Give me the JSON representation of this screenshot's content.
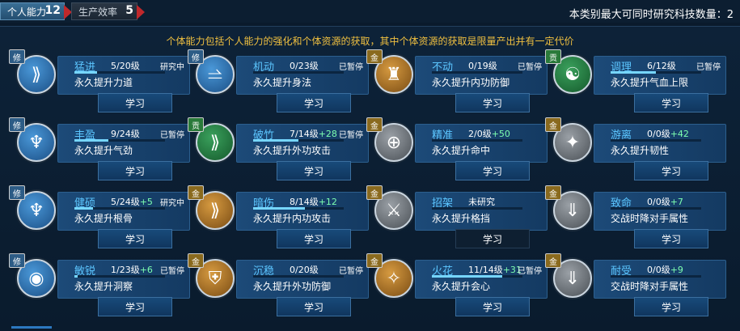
{
  "tabs": [
    {
      "label": "个人能力",
      "count": "12"
    },
    {
      "label": "生产效率",
      "count": "5"
    }
  ],
  "capacity_text": "本类别最大可同时研究科技数量：2",
  "description": "个体能力包括个人能力的强化和个体资源的获取，其中个体资源的获取是限量产出并有一定代价",
  "learn_label": "学习",
  "skills": [
    {
      "name": "猛进",
      "level": "5/20级",
      "bonus": "",
      "status": "研究中",
      "effect": "永久提升力道",
      "badge": "修",
      "color": "blue",
      "icon": "sprint-icon",
      "progress": 0.25,
      "glyph": "⟫"
    },
    {
      "name": "机动",
      "level": "0/23级",
      "bonus": "",
      "status": "已暂停",
      "effect": "永久提升身法",
      "badge": "修",
      "color": "blue",
      "icon": "boot-icon",
      "progress": 0.0,
      "glyph": "⥬"
    },
    {
      "name": "不动",
      "level": "0/19级",
      "bonus": "",
      "status": "已暂停",
      "effect": "永久提升内功防御",
      "badge": "金",
      "color": "gold",
      "icon": "stance-icon",
      "progress": 0.0,
      "glyph": "♜"
    },
    {
      "name": "调理",
      "level": "6/12级",
      "bonus": "",
      "status": "已暂停",
      "effect": "永久提升气血上限",
      "badge": "贡",
      "color": "green",
      "icon": "meditate-icon",
      "progress": 0.5,
      "glyph": "☯"
    },
    {
      "name": "丰盈",
      "level": "9/24级",
      "bonus": "",
      "status": "已暂停",
      "effect": "永久提升气劲",
      "badge": "修",
      "color": "blue",
      "icon": "muscle-icon",
      "progress": 0.375,
      "glyph": "♆"
    },
    {
      "name": "破竹",
      "level": "7/14级",
      "bonus": "+28",
      "status": "已暂停",
      "effect": "永久提升外功攻击",
      "badge": "贡",
      "color": "green",
      "icon": "dash-icon",
      "progress": 0.5,
      "glyph": "⟫"
    },
    {
      "name": "精准",
      "level": "2/0级",
      "bonus": "+50",
      "status": "",
      "effect": "永久提升命中",
      "badge": "金",
      "color": "grey",
      "icon": "crosshair-icon",
      "progress": 0.0,
      "glyph": "⊕"
    },
    {
      "name": "游离",
      "level": "0/0级",
      "bonus": "+42",
      "status": "",
      "effect": "永久提升韧性",
      "badge": "金",
      "color": "grey",
      "icon": "shuriken-icon",
      "progress": 0.0,
      "glyph": "✦"
    },
    {
      "name": "健硕",
      "level": "5/24级",
      "bonus": "+5",
      "status": "研究中",
      "effect": "永久提升根骨",
      "badge": "修",
      "color": "blue",
      "icon": "strength-icon",
      "progress": 0.208,
      "glyph": "♆"
    },
    {
      "name": "暗伤",
      "level": "8/14级",
      "bonus": "+12",
      "status": "",
      "effect": "永久提升内功攻击",
      "badge": "金",
      "color": "gold",
      "icon": "strike-icon",
      "progress": 0.57,
      "glyph": "⟫"
    },
    {
      "name": "招架",
      "level": "未研究",
      "bonus": "",
      "status": "",
      "effect": "永久提升格挡",
      "badge": "金",
      "color": "grey",
      "icon": "parry-icon",
      "progress": 0.0,
      "glyph": "⚔"
    },
    {
      "name": "致命",
      "level": "0/0级",
      "bonus": "+7",
      "status": "",
      "effect": "交战时降对手属性",
      "badge": "金",
      "color": "grey",
      "icon": "drop-icon",
      "progress": 0.0,
      "glyph": "⇓"
    },
    {
      "name": "敏锐",
      "level": "1/23级",
      "bonus": "+6",
      "status": "已暂停",
      "effect": "永久提升洞察",
      "badge": "修",
      "color": "blue",
      "icon": "eye-icon",
      "progress": 0.04,
      "glyph": "◉"
    },
    {
      "name": "沉稳",
      "level": "0/20级",
      "bonus": "",
      "status": "已暂停",
      "effect": "永久提升外功防御",
      "badge": "金",
      "color": "gold",
      "icon": "shield-icon",
      "progress": 0.0,
      "glyph": "⛨"
    },
    {
      "name": "火花",
      "level": "11/14级",
      "bonus": "+31",
      "status": "已暂停",
      "effect": "永久提升会心",
      "badge": "金",
      "color": "gold",
      "icon": "spark-icon",
      "progress": 0.78,
      "glyph": "✧"
    },
    {
      "name": "耐受",
      "level": "0/0级",
      "bonus": "+9",
      "status": "",
      "effect": "交战时降对手属性",
      "badge": "金",
      "color": "grey",
      "icon": "drop-icon",
      "progress": 0.0,
      "glyph": "⇓"
    }
  ]
}
